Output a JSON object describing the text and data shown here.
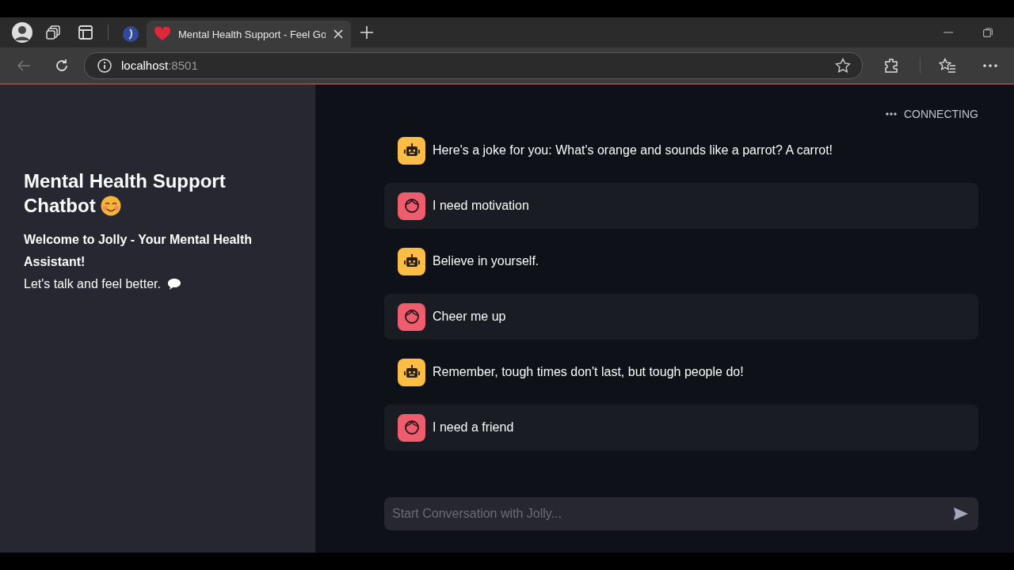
{
  "browser": {
    "tabs": [
      {
        "kind": "pinned",
        "selected": false
      },
      {
        "kind": "page",
        "title": "Mental Health Support - Feel Go",
        "selected": true
      }
    ],
    "address": {
      "host": "localhost",
      "port": ":8501"
    }
  },
  "sidebar": {
    "title": "Mental Health Support Chatbot",
    "welcome": "Welcome to Jolly - Your Mental Health Assistant!",
    "tagline": "Let's talk and feel better."
  },
  "status": "CONNECTING",
  "messages": [
    {
      "kind": "assistant",
      "text": "Here's a joke for you: What's orange and sounds like a parrot? A carrot!"
    },
    {
      "kind": "user",
      "text": "I need motivation"
    },
    {
      "kind": "assistant",
      "text": "Believe in yourself."
    },
    {
      "kind": "user",
      "text": "Cheer me up"
    },
    {
      "kind": "assistant",
      "text": "Remember, tough times don't last, but tough people do!"
    },
    {
      "kind": "user",
      "text": "I need a friend"
    }
  ],
  "chat_input": {
    "placeholder": "Start Conversation with Jolly..."
  }
}
